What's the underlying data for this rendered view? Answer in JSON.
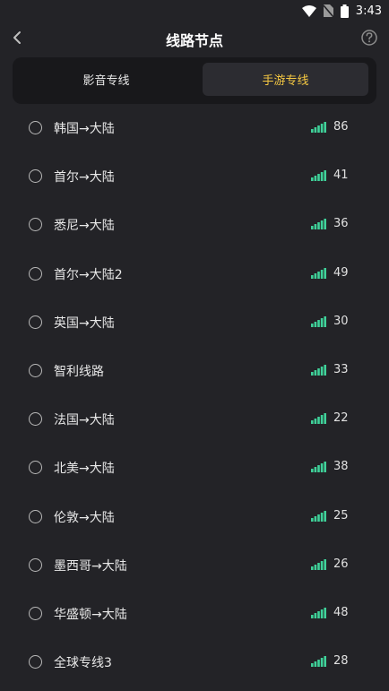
{
  "statusbar": {
    "time": "3:43"
  },
  "header": {
    "title": "线路节点"
  },
  "tabs": [
    {
      "label": "影音专线",
      "selected": false
    },
    {
      "label": "手游专线",
      "selected": true
    }
  ],
  "colors": {
    "accent": "#f5c842",
    "signal": "#3fd29a",
    "background": "#232327"
  },
  "nodes": [
    {
      "name": "韩国→大陆",
      "ping": "86"
    },
    {
      "name": "首尔→大陆",
      "ping": "41"
    },
    {
      "name": "悉尼→大陆",
      "ping": "36"
    },
    {
      "name": "首尔→大陆2",
      "ping": "49"
    },
    {
      "name": "英国→大陆",
      "ping": "30"
    },
    {
      "name": "智利线路",
      "ping": "33"
    },
    {
      "name": "法国→大陆",
      "ping": "22"
    },
    {
      "name": "北美→大陆",
      "ping": "38"
    },
    {
      "name": "伦敦→大陆",
      "ping": "25"
    },
    {
      "name": "墨西哥→大陆",
      "ping": "26"
    },
    {
      "name": "华盛顿→大陆",
      "ping": "48"
    },
    {
      "name": "全球专线3",
      "ping": "28"
    }
  ]
}
